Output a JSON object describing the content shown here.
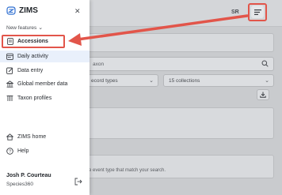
{
  "app": {
    "logo_text": "ZIMS",
    "new_features_label": "New features"
  },
  "sidebar": {
    "items": [
      {
        "label": "Accessions",
        "icon": "document-icon"
      },
      {
        "label": "Daily activity",
        "icon": "calendar-icon"
      },
      {
        "label": "Data entry",
        "icon": "edit-icon"
      },
      {
        "label": "Global member data",
        "icon": "building-icon"
      },
      {
        "label": "Taxon profiles",
        "icon": "taxonomy-icon"
      }
    ],
    "bottom_items": [
      {
        "label": "ZIMS home",
        "icon": "home-icon"
      },
      {
        "label": "Help",
        "icon": "help-icon"
      }
    ],
    "user": {
      "name": "Josh P. Courteau",
      "org": "Species360"
    }
  },
  "background": {
    "avatar_text": "SR",
    "search_placeholder": "axon",
    "select_1": "ecord types",
    "select_2": "15 collections",
    "bottom_text": "e event type that match your search."
  },
  "colors": {
    "highlight": "#e2554a",
    "active_bg": "#e9f0fb",
    "logo_blue": "#2f6fd1"
  }
}
